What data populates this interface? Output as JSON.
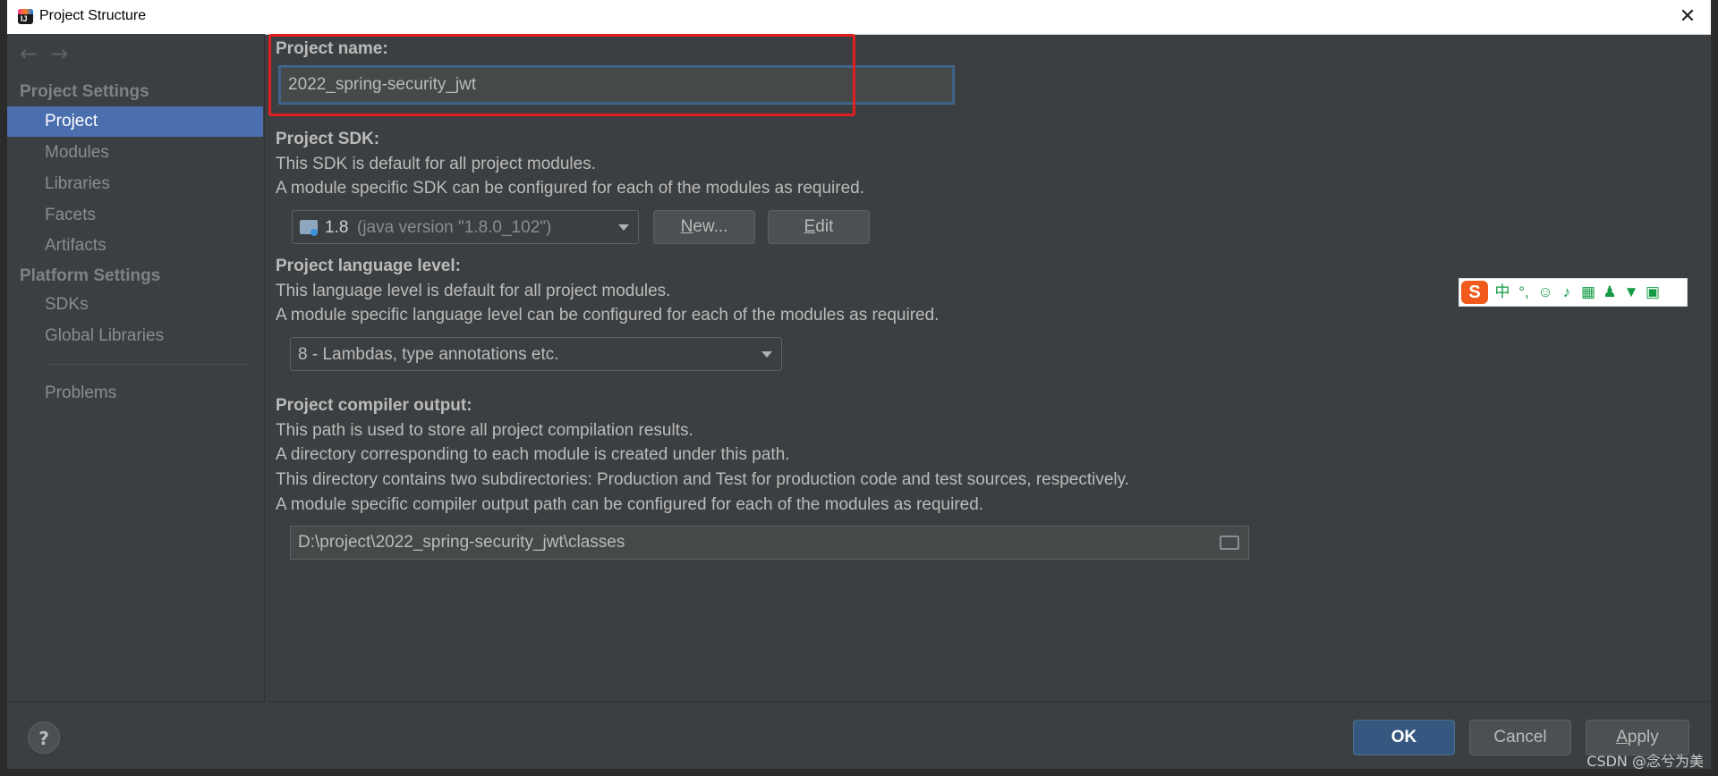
{
  "window": {
    "title": "Project Structure",
    "close_glyph": "✕"
  },
  "nav": {
    "back": "←",
    "forward": "→"
  },
  "sidebar": {
    "project_settings_header": "Project Settings",
    "platform_settings_header": "Platform Settings",
    "items": [
      {
        "label": "Project",
        "selected": true
      },
      {
        "label": "Modules"
      },
      {
        "label": "Libraries"
      },
      {
        "label": "Facets"
      },
      {
        "label": "Artifacts"
      },
      {
        "label": "SDKs"
      },
      {
        "label": "Global Libraries"
      },
      {
        "label": "Problems"
      }
    ]
  },
  "project": {
    "name_label": "Project name:",
    "name_value": "2022_spring-security_jwt",
    "sdk_label": "Project SDK:",
    "sdk_desc1": "This SDK is default for all project modules.",
    "sdk_desc2": "A module specific SDK can be configured for each of the modules as required.",
    "sdk_version": "1.8",
    "sdk_detail": "(java version \"1.8.0_102\")",
    "new_button_mnemonic": "N",
    "new_button_rest": "ew...",
    "edit_button_mnemonic": "E",
    "edit_button_rest": "dit",
    "lang_label": "Project language level:",
    "lang_desc1": "This language level is default for all project modules.",
    "lang_desc2": "A module specific language level can be configured for each of the modules as required.",
    "lang_value": "8 - Lambdas, type annotations etc.",
    "output_label": "Project compiler output:",
    "output_desc1": "This path is used to store all project compilation results.",
    "output_desc2": "A directory corresponding to each module is created under this path.",
    "output_desc3": "This directory contains two subdirectories: Production and Test for production code and test sources, respectively.",
    "output_desc4": "A module specific compiler output path can be configured for each of the modules as required.",
    "output_path": "D:\\project\\2022_spring-security_jwt\\classes"
  },
  "ime_toolbar": {
    "logo": "S",
    "mode": "中",
    "punct": "°,"
  },
  "buttons": {
    "help": "?",
    "ok": "OK",
    "cancel": "Cancel",
    "apply_mnemonic": "A",
    "apply_rest": "pply"
  },
  "watermark": "CSDN @念兮为美",
  "colors": {
    "accent_selected": "#4b6eaf",
    "highlight_box": "#e02020",
    "background": "#3c3f41",
    "primary_button": "#365880"
  }
}
